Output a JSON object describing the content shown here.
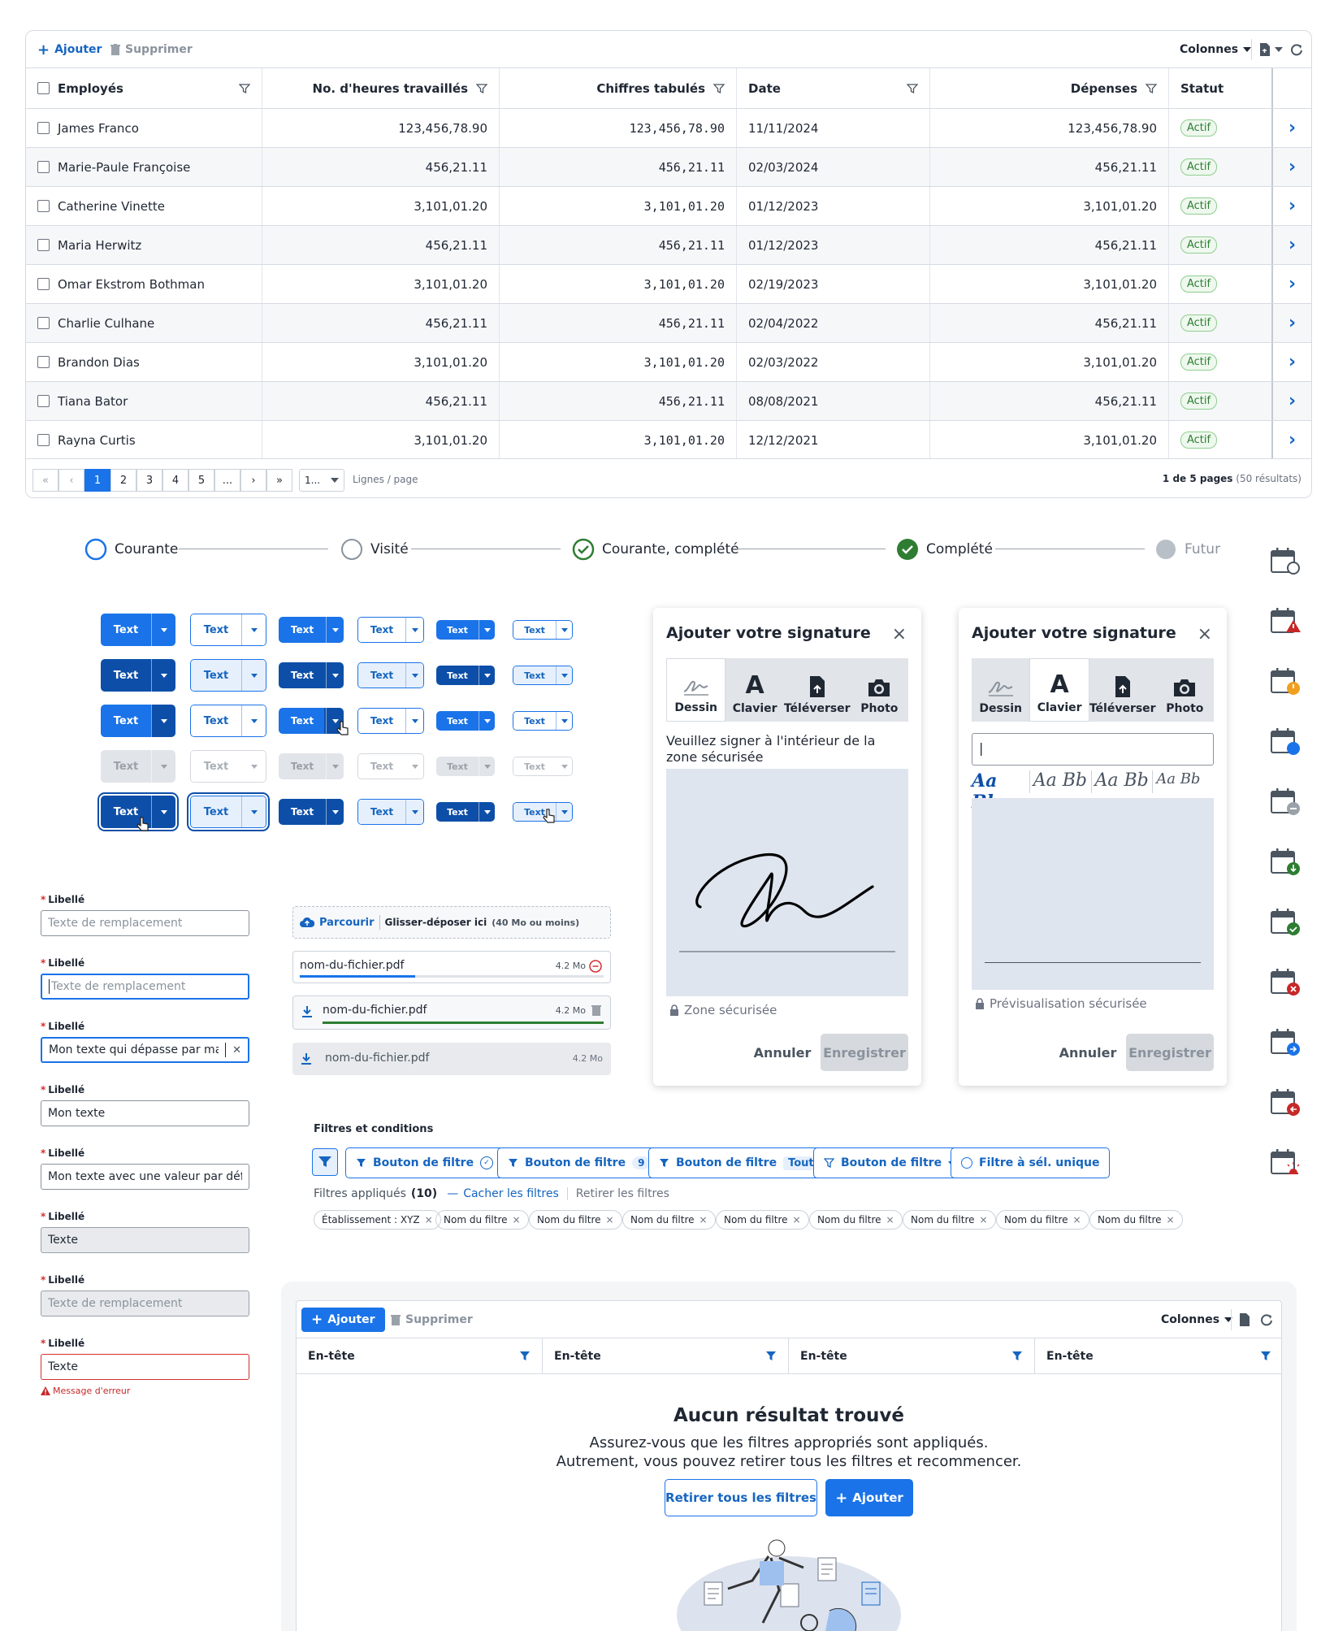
{
  "grid": {
    "toolbar": {
      "add": "Ajouter",
      "delete": "Supprimer",
      "columns": "Colonnes"
    },
    "headers": [
      "Employés",
      "No. d'heures travaillés",
      "Chiffres tabulés",
      "Date",
      "Dépenses",
      "Statut"
    ],
    "rows": [
      {
        "name": "James Franco",
        "hours": "123,456,78.90",
        "tab": "123,456,78.90",
        "date": "11/11/2024",
        "exp": "123,456,78.90",
        "status": "Actif"
      },
      {
        "name": "Marie-Paule Françoise",
        "hours": "456,21.11",
        "tab": "456,21.11",
        "date": "02/03/2024",
        "exp": "456,21.11",
        "status": "Actif"
      },
      {
        "name": "Catherine Vinette",
        "hours": "3,101,01.20",
        "tab": "3,101,01.20",
        "date": "01/12/2023",
        "exp": "3,101,01.20",
        "status": "Actif"
      },
      {
        "name": "Maria Herwitz",
        "hours": "456,21.11",
        "tab": "456,21.11",
        "date": "01/12/2023",
        "exp": "456,21.11",
        "status": "Actif"
      },
      {
        "name": "Omar Ekstrom Bothman",
        "hours": "3,101,01.20",
        "tab": "3,101,01.20",
        "date": "02/19/2023",
        "exp": "3,101,01.20",
        "status": "Actif"
      },
      {
        "name": "Charlie Culhane",
        "hours": "456,21.11",
        "tab": "456,21.11",
        "date": "02/04/2022",
        "exp": "456,21.11",
        "status": "Actif"
      },
      {
        "name": "Brandon Dias",
        "hours": "3,101,01.20",
        "tab": "3,101,01.20",
        "date": "02/03/2022",
        "exp": "3,101,01.20",
        "status": "Actif"
      },
      {
        "name": "Tiana Bator",
        "hours": "456,21.11",
        "tab": "456,21.11",
        "date": "08/08/2021",
        "exp": "456,21.11",
        "status": "Actif"
      },
      {
        "name": "Rayna Curtis",
        "hours": "3,101,01.20",
        "tab": "3,101,01.20",
        "date": "12/12/2021",
        "exp": "3,101,01.20",
        "status": "Actif"
      }
    ],
    "pager": {
      "pages": [
        "1",
        "2",
        "3",
        "4",
        "5",
        "..."
      ],
      "current": "1",
      "per_page": "1...",
      "per_page_label": "Lignes / page",
      "summary": "1 de 5 pages",
      "results": "(50 résultats)"
    }
  },
  "stepper": [
    {
      "label": "Courante",
      "state": "current"
    },
    {
      "label": "Visité",
      "state": "visited"
    },
    {
      "label": "Courante, complété",
      "state": "current-complete"
    },
    {
      "label": "Complété",
      "state": "complete"
    },
    {
      "label": "Futur",
      "state": "future"
    }
  ],
  "split_button_label": "Text",
  "form": {
    "label": "Libellé",
    "fields": [
      {
        "placeholder": "Texte de remplacement",
        "value": "",
        "state": "default"
      },
      {
        "placeholder": "Texte de remplacement",
        "value": "",
        "state": "focus"
      },
      {
        "placeholder": "",
        "value": "Mon texte qui dépasse par man...",
        "state": "focus-clear"
      },
      {
        "placeholder": "",
        "value": "Mon texte",
        "state": "filled"
      },
      {
        "placeholder": "",
        "value": "Mon texte avec une valeur par défaut",
        "state": "filled"
      },
      {
        "placeholder": "",
        "value": "Texte",
        "state": "readonly"
      },
      {
        "placeholder": "Texte de remplacement",
        "value": "",
        "state": "disabled"
      },
      {
        "placeholder": "",
        "value": "Texte",
        "state": "error"
      }
    ],
    "error_message": "Message d'erreur"
  },
  "upload": {
    "browse": "Parcourir",
    "drop": "Glisser-déposer ici",
    "limit": "(40 Mo ou moins)",
    "files": [
      {
        "name": "nom-du-fichier.pdf",
        "size": "4.2 Mo",
        "progress": 0.38,
        "state": "uploading"
      },
      {
        "name": "nom-du-fichier.pdf",
        "size": "4.2 Mo",
        "progress": 1.0,
        "state": "done"
      },
      {
        "name": "nom-du-fichier.pdf",
        "size": "4.2 Mo",
        "progress": 1.0,
        "state": "disabled"
      }
    ]
  },
  "signature_left": {
    "title": "Ajouter votre signature",
    "tabs": [
      "Dessin",
      "Clavier",
      "Téléverser",
      "Photo"
    ],
    "active_tab": "Dessin",
    "instruction": "Veuillez signer à l'intérieur de la zone sécurisée",
    "zone": "Zone sécurisée",
    "cancel": "Annuler",
    "save": "Enregistrer"
  },
  "signature_right": {
    "title": "Ajouter votre signature",
    "tabs": [
      "Dessin",
      "Clavier",
      "Téléverser",
      "Photo"
    ],
    "active_tab": "Clavier",
    "input_value": "|",
    "font_samples": [
      "Aa Bb",
      "Aa Bb",
      "Aa Bb",
      "Aa Bb"
    ],
    "zone": "Prévisualisation sécurisée",
    "cancel": "Annuler",
    "save": "Enregistrer"
  },
  "filters": {
    "title": "Filtres et conditions",
    "buttons": [
      {
        "label": "Bouton de filtre",
        "extra": "✓",
        "kind": "check"
      },
      {
        "label": "Bouton de filtre",
        "extra": "9",
        "kind": "count"
      },
      {
        "label": "Bouton de filtre",
        "extra": "Tout",
        "kind": "tag"
      },
      {
        "label": "Bouton de filtre",
        "extra": "",
        "kind": "dropdown"
      },
      {
        "label": "Filtre à sél. unique",
        "extra": "",
        "kind": "radio"
      }
    ],
    "applied_label": "Filtres appliqués",
    "applied_count": "(10)",
    "hide": "Cacher les filtres",
    "remove": "Retirer les filtres",
    "chips": [
      "Établissement : XYZ",
      "Nom du filtre",
      "Nom du filtre",
      "Nom du filtre",
      "Nom du filtre",
      "Nom du filtre",
      "Nom du filtre",
      "Nom du filtre",
      "Nom du filtre"
    ]
  },
  "empty_grid": {
    "add": "Ajouter",
    "delete": "Supprimer",
    "columns": "Colonnes",
    "headers": [
      "En-tête",
      "En-tête",
      "En-tête",
      "En-tête"
    ],
    "title": "Aucun résultat trouvé",
    "line1": "Assurez-vous que les filtres appropriés sont appliqués.",
    "line2": "Autrement, vous pouvez retirer tous les filtres et recommencer.",
    "remove_all": "Retirer tous les filtres",
    "add_btn": "Ajouter"
  },
  "colors": {
    "primary": "#1a73e8",
    "primary_dark": "#0d4fa8",
    "success": "#2e7d32",
    "error": "#d32f2f",
    "warning": "#f0a020"
  },
  "right_icons": [
    "calendar-clock-icon",
    "calendar-warning-icon",
    "calendar-alert-icon",
    "calendar-dot-icon",
    "calendar-minus-icon",
    "calendar-download-icon",
    "calendar-check-icon",
    "calendar-error-icon",
    "calendar-forward-icon",
    "calendar-back-icon",
    "calendar-alarm-icon"
  ]
}
